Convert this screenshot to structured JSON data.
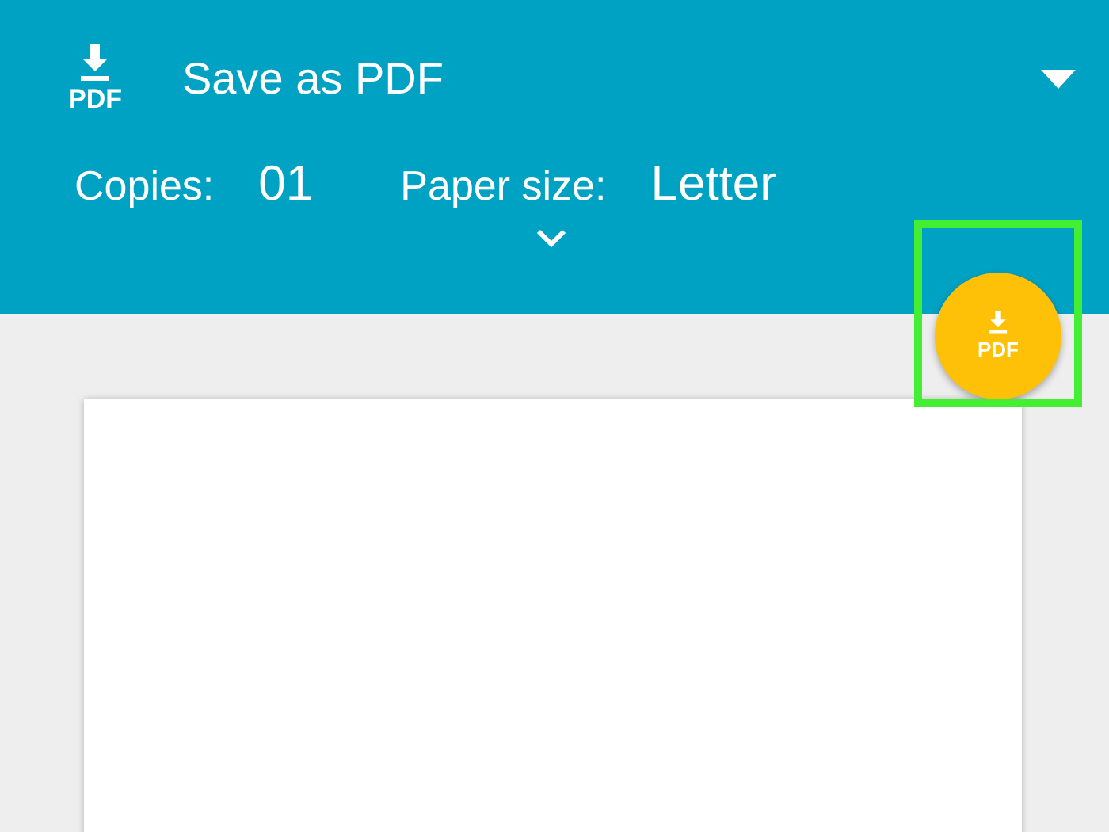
{
  "header": {
    "icon_label": "PDF",
    "title": "Save as PDF",
    "copies": {
      "label": "Copies:",
      "value": "01"
    },
    "paper_size": {
      "label": "Paper size:",
      "value": "Letter"
    }
  },
  "fab": {
    "label": "PDF"
  },
  "highlight": {
    "color": "#44ee33"
  }
}
